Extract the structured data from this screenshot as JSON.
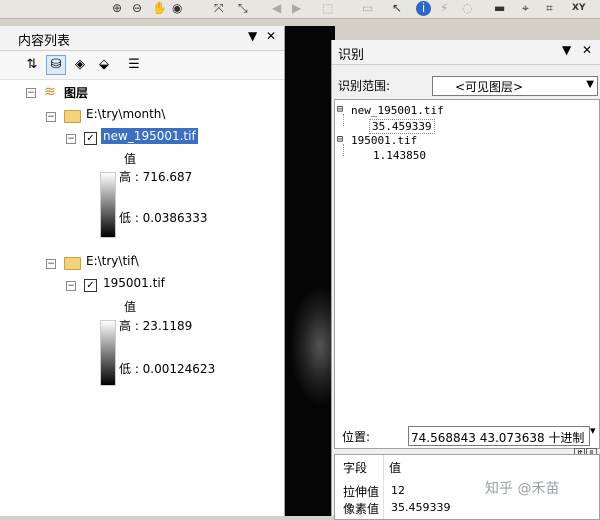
{
  "toc": {
    "title": "内容列表",
    "pin": "▼",
    "close": "✕",
    "root_label": "图层",
    "groups": [
      {
        "folder": "E:\\try\\month\\",
        "layer": "new_195001.tif",
        "value_label": "值",
        "high": "高 : 716.687",
        "low": "低 : 0.0386333"
      },
      {
        "folder": "E:\\try\\tif\\",
        "layer": "195001.tif",
        "value_label": "值",
        "high": "高 : 23.1189",
        "low": "低 : 0.00124623"
      }
    ],
    "expander_minus": "−",
    "check_mark": "✓"
  },
  "identify": {
    "title": "识别",
    "pin": "▼",
    "close": "✕",
    "scope_label": "识别范围:",
    "scope_value": "<可见图层>",
    "combo_arrow": "▼",
    "tree": [
      {
        "name": "new_195001.tif",
        "value": "35.459339"
      },
      {
        "name": "195001.tif",
        "value": "1.143850"
      }
    ],
    "position_label": "位置:",
    "position_value": "74.568843   43.073638  十进制",
    "position_arrow": "▾",
    "attr_header_field": "字段",
    "attr_header_value": "值",
    "rows": [
      {
        "field": "拉伸值",
        "value": "12"
      },
      {
        "field": "像素值",
        "value": "35.459339"
      }
    ]
  },
  "watermark": "知乎 @禾苗"
}
